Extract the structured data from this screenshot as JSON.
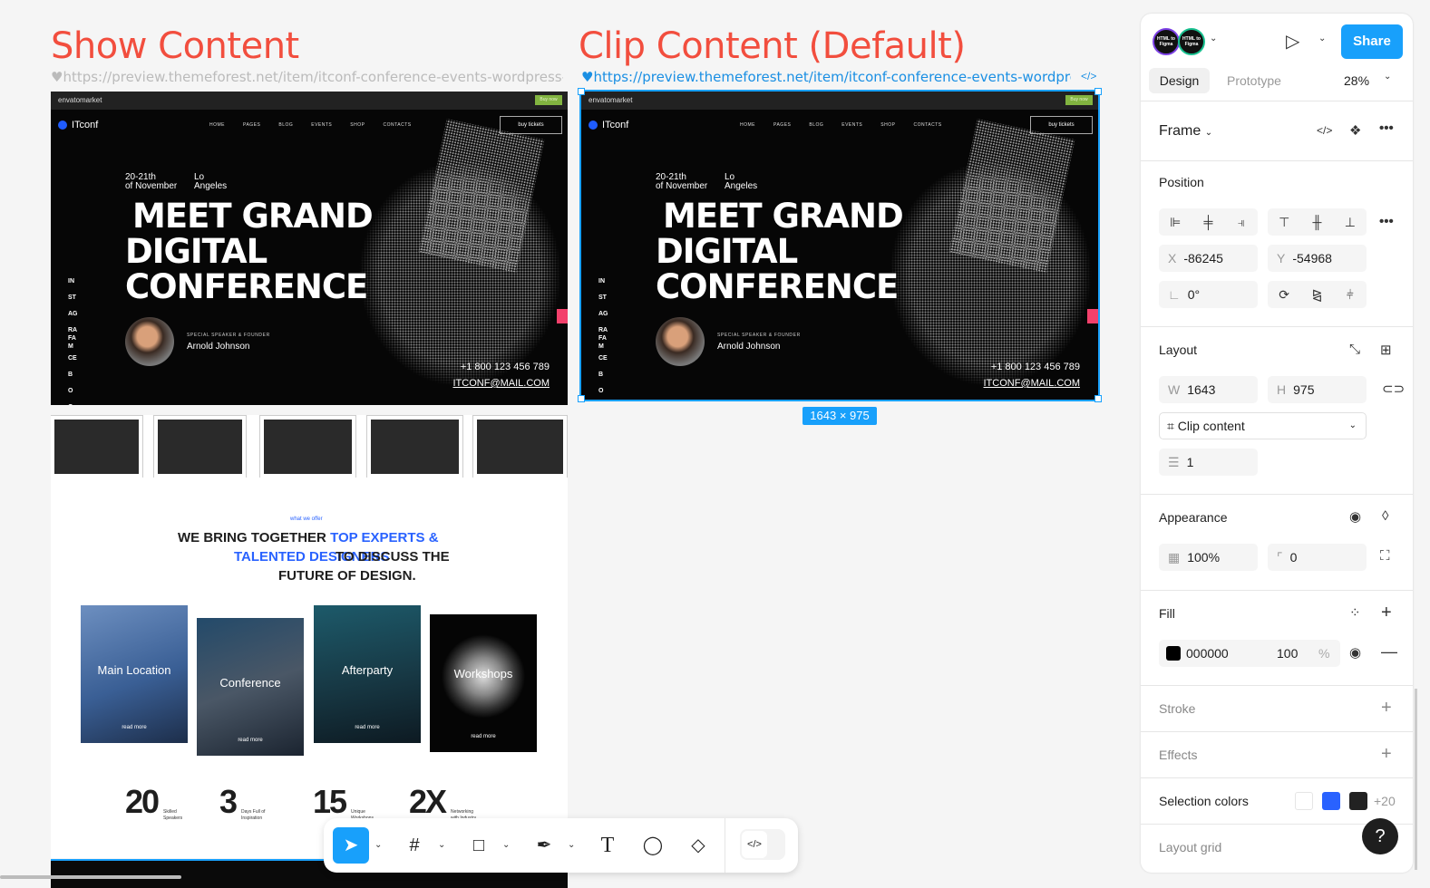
{
  "canvas": {
    "show_label": "Show Content",
    "clip_label": "Clip Content (Default)",
    "show_url": "♥https://preview.themeforest.net/item/itconf-conference-events-wordpress-theme/...",
    "clip_url": "♥https://preview.themeforest.net/item/itconf-conference-events-wordpress-the...",
    "code_icon": "</>",
    "size_badge": "1643 × 975"
  },
  "hero": {
    "envato": "envatomarket",
    "buy_now": "Buy now",
    "brand": "ITconf",
    "nav": [
      "HOME",
      "PAGES",
      "BLOG",
      "EVENTS",
      "SHOP",
      "CONTACTS"
    ],
    "tickets": "buy tickets",
    "date_line1": "20-21th",
    "date_line2": "of November",
    "loc_line1": "Lo",
    "loc_line2": "Angeles",
    "title": [
      "MEET GRAND",
      "DIGITAL",
      "CONFERENCE"
    ],
    "side": [
      "IN",
      "ST",
      "AG",
      "RA",
      "FA",
      "M",
      "CE",
      "B",
      "O",
      "O"
    ],
    "speaker_role": "SPECIAL SPEAKER & FOUNDER",
    "speaker_name": "Arnold Johnson",
    "phone": "+1 800 123 456 789",
    "email": "ITCONF@MAIL.COM"
  },
  "offer": {
    "kicker": "what we offer",
    "line1_dark": "WE BRING TOGETHER",
    "line1_blue": "TOP EXPERTS &",
    "line2_blue": "TALENTED DESIGNERS",
    "line2_dark": "TO DISCUSS THE",
    "line3": "FUTURE OF DESIGN.",
    "cards": [
      {
        "label": "Main Location",
        "more": "read more"
      },
      {
        "label": "Conference",
        "more": "read more"
      },
      {
        "label": "Afterparty",
        "more": "read more"
      },
      {
        "label": "Workshops",
        "more": "read more"
      }
    ],
    "stats": [
      {
        "n": "20",
        "d": "Skilled Speakers"
      },
      {
        "n": "3",
        "d": "Days Full of Inspiration"
      },
      {
        "n": "15",
        "d": "Unique Workshops"
      },
      {
        "n": "2X",
        "d": "Networking with Industry"
      }
    ]
  },
  "panel": {
    "avatar_text": "HTML to Figma",
    "share": "Share",
    "tabs": [
      "Design",
      "Prototype"
    ],
    "zoom": "28%",
    "frame": "Frame",
    "position": {
      "title": "Position",
      "x_label": "X",
      "x": "-86245",
      "y_label": "Y",
      "y": "-54968",
      "rotation": "0°"
    },
    "layout": {
      "title": "Layout",
      "w_label": "W",
      "w": "1643",
      "h_label": "H",
      "h": "975",
      "clip": "Clip content",
      "gap": "1"
    },
    "appearance": {
      "title": "Appearance",
      "opacity": "100%",
      "radius": "0"
    },
    "fill": {
      "title": "Fill",
      "hex": "000000",
      "opacity": "100",
      "pct": "%",
      "color": "#000000"
    },
    "stroke": "Stroke",
    "effects": "Effects",
    "selection_colors": {
      "title": "Selection colors",
      "colors": [
        "#ffffff",
        "#2962ff",
        "#222222"
      ],
      "more": "+20"
    },
    "layout_grid": "Layout grid",
    "help": "?"
  },
  "colors": {
    "accent": "#18a0fb",
    "label_red": "#f24e3e",
    "brand_blue": "#1f5cff"
  }
}
